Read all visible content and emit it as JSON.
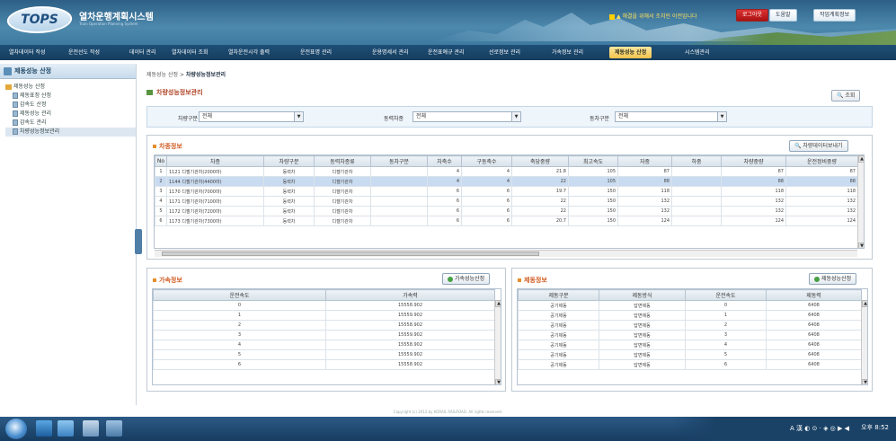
{
  "header": {
    "logo_text": "TOPS",
    "app_title": "열차운행계획시스템",
    "app_subtitle": "Train Operation Planning System",
    "notice": "▲ 해결을 위해서 조치인 이전입니다",
    "btn_logout": "로그아웃",
    "btn_help": "도움말",
    "btn_workplan": "작업계획정보"
  },
  "nav": {
    "items": [
      "열차데이터 작성",
      "운전선도 작성",
      "데이터 관리",
      "열차데이터 조회",
      "열차운전시각 출력",
      "운전표명 관리",
      "운용명세서 관리",
      "운전표예규 관리",
      "선로정보 관리",
      "가속정보 관리",
      "제동성능 산정",
      "시스템관리"
    ],
    "active_index": 10
  },
  "sidebar": {
    "title": "제동성능 산정",
    "tree": [
      {
        "label": "제동성능 산정",
        "type": "folder"
      },
      {
        "label": "제동표정 산정",
        "type": "doc"
      },
      {
        "label": "감속도 산정",
        "type": "doc"
      },
      {
        "label": "제동성능 관리",
        "type": "doc"
      },
      {
        "label": "감속도 관리",
        "type": "doc"
      },
      {
        "label": "차량성능정보관리",
        "type": "doc",
        "selected": true
      }
    ]
  },
  "breadcrumb": {
    "root": "제동성능 산정",
    "sep": " > ",
    "current": "차량성능정보관리"
  },
  "page_title": "차량성능정보관리",
  "search_button": "조회",
  "filters": {
    "vehicle_type": {
      "label": "차량구분",
      "value": "전체"
    },
    "power_type": {
      "label": "동력차종",
      "value": "전체"
    },
    "car_type": {
      "label": "동차구분",
      "value": "전체"
    }
  },
  "vehicle_panel": {
    "title": "차종정보",
    "button": "차량데이터보내기",
    "columns": [
      "No",
      "차종",
      "차량구분",
      "동력차종류",
      "동차구분",
      "차축수",
      "구동축수",
      "축당중량",
      "최고속도",
      "자중",
      "하중",
      "차량중량",
      "운전정비중량"
    ],
    "rows": [
      [
        "1",
        "1121 디젤기관차(2000마)",
        "동력차",
        "디젤기관차",
        "",
        "4",
        "4",
        "21.8",
        "105",
        "87",
        "",
        "87",
        "87"
      ],
      [
        "2",
        "1144 디젤기관차(4400마)",
        "동력차",
        "디젤기관차",
        "",
        "4",
        "4",
        "22",
        "105",
        "88",
        "",
        "88",
        "88"
      ],
      [
        "3",
        "1170 디젤기관차(7000마)",
        "동력차",
        "디젤기관차",
        "",
        "6",
        "6",
        "19.7",
        "150",
        "118",
        "",
        "118",
        "118"
      ],
      [
        "4",
        "1171 디젤기관차(7100마)",
        "동력차",
        "디젤기관차",
        "",
        "6",
        "6",
        "22",
        "150",
        "132",
        "",
        "132",
        "132"
      ],
      [
        "5",
        "1172 디젤기관차(7200마)",
        "동력차",
        "디젤기관차",
        "",
        "6",
        "6",
        "22",
        "150",
        "132",
        "",
        "132",
        "132"
      ],
      [
        "6",
        "1173 디젤기관차(7300마)",
        "동력차",
        "디젤기관차",
        "",
        "6",
        "6",
        "20.7",
        "150",
        "124",
        "",
        "124",
        "124"
      ]
    ],
    "selected_row": 1
  },
  "accel_panel": {
    "title": "가속정보",
    "button": "가속성능산정",
    "columns": [
      "운전속도",
      "가속력"
    ],
    "rows": [
      [
        "0",
        "15558.902"
      ],
      [
        "1",
        "15559.902"
      ],
      [
        "2",
        "15558.902"
      ],
      [
        "3",
        "15559.902"
      ],
      [
        "4",
        "15558.902"
      ],
      [
        "5",
        "15559.902"
      ],
      [
        "6",
        "15558.902"
      ]
    ]
  },
  "brake_panel": {
    "title": "제동정보",
    "button": "제동성능산정",
    "columns": [
      "제동구분",
      "제동방식",
      "운전속도",
      "제동력"
    ],
    "rows": [
      [
        "공기제동",
        "답면제동",
        "0",
        "6408"
      ],
      [
        "공기제동",
        "답면제동",
        "1",
        "6408"
      ],
      [
        "공기제동",
        "답면제동",
        "2",
        "6408"
      ],
      [
        "공기제동",
        "답면제동",
        "3",
        "6408"
      ],
      [
        "공기제동",
        "답면제동",
        "4",
        "6408"
      ],
      [
        "공기제동",
        "답면제동",
        "5",
        "6408"
      ],
      [
        "공기제동",
        "답면제동",
        "6",
        "6408"
      ]
    ]
  },
  "footer": {
    "copyright": "Copyright (c) 2012 by KORAIL RAILROAD. All rights reserved."
  },
  "taskbar": {
    "tray": "A 漢 ◐ ⊙ · ◈ ◎ ▶ ◀",
    "clock": "오후 8:52"
  },
  "colors": {
    "accent": "#1e4f77",
    "active_tab": "#f2c34c",
    "title": "#b04324",
    "header_text": "#d05a20"
  }
}
